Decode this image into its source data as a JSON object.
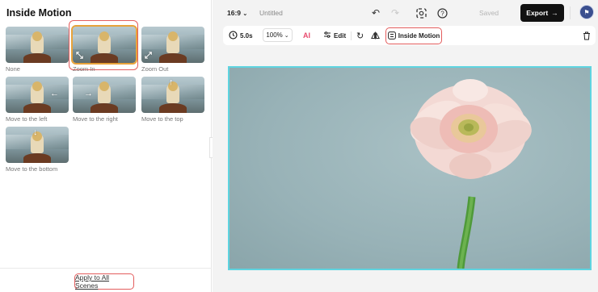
{
  "left_panel": {
    "title": "Inside Motion",
    "presets": [
      {
        "label": "None",
        "arrow": ""
      },
      {
        "label": "Zoom In",
        "arrow": "⤡"
      },
      {
        "label": "Zoom Out",
        "arrow": "⤢"
      },
      {
        "label": "Move to the left",
        "arrow": "←"
      },
      {
        "label": "Move to the right",
        "arrow": "→"
      },
      {
        "label": "Move to the top",
        "arrow": "↑"
      },
      {
        "label": "Move to the bottom",
        "arrow": "↓"
      }
    ],
    "selected": "Zoom In",
    "apply_label": "Apply to All Scenes"
  },
  "topbar": {
    "aspect_ratio": "16:9",
    "document_title": "Untitled",
    "saved_label": "Saved",
    "export_label": "Export",
    "icons": [
      "undo-icon",
      "redo-icon",
      "screenshot-icon",
      "help-icon",
      "avatar"
    ]
  },
  "toolbar": {
    "duration": "5.0s",
    "zoom": "100%",
    "ai_label": "AI",
    "edit_label": "Edit",
    "inside_motion_label": "Inside Motion",
    "icons": [
      "clock-icon",
      "ai-icon",
      "sliders-icon",
      "rotate-icon",
      "flip-icon",
      "inside-motion-icon",
      "trash-icon"
    ]
  },
  "colors": {
    "accent_highlight": "#e35d5d",
    "canvas_border": "#5ed4e0",
    "export_bg": "#111111",
    "selected_border": "#e8a33a"
  }
}
